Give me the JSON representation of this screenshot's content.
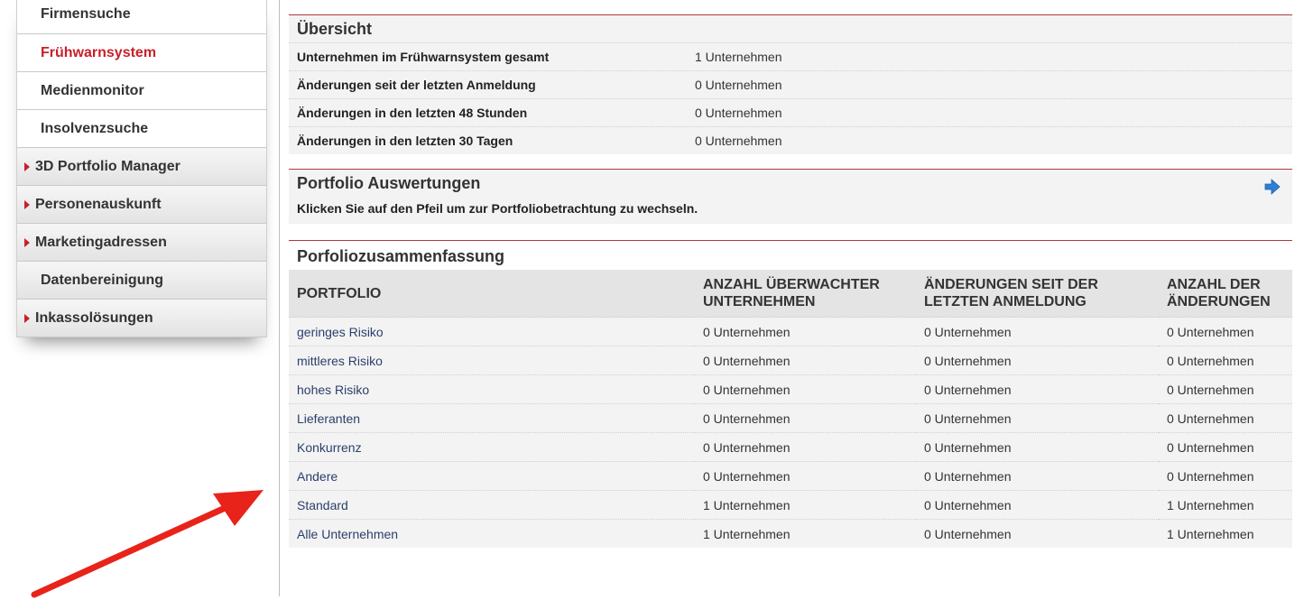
{
  "sidebar": {
    "items": [
      {
        "label": "Firmensuche",
        "type": "plain",
        "active": false
      },
      {
        "label": "Frühwarnsystem",
        "type": "plain",
        "active": true
      },
      {
        "label": "Medienmonitor",
        "type": "plain",
        "active": false
      },
      {
        "label": "Insolvenzsuche",
        "type": "plain",
        "active": false
      },
      {
        "label": "3D Portfolio Manager",
        "type": "group",
        "active": false
      },
      {
        "label": "Personenauskunft",
        "type": "group",
        "active": false
      },
      {
        "label": "Marketingadressen",
        "type": "group",
        "active": false
      },
      {
        "label": "Datenbereinigung",
        "type": "group-plain",
        "active": false
      },
      {
        "label": "Inkassolösungen",
        "type": "group",
        "active": false
      }
    ]
  },
  "overview": {
    "title": "Übersicht",
    "rows": [
      {
        "label": "Unternehmen im Frühwarnsystem gesamt",
        "value": "1 Unternehmen"
      },
      {
        "label": "Änderungen seit der letzten Anmeldung",
        "value": "0 Unternehmen"
      },
      {
        "label": "Änderungen in den letzten 48 Stunden",
        "value": "0 Unternehmen"
      },
      {
        "label": "Änderungen in den letzten 30 Tagen",
        "value": "0 Unternehmen"
      }
    ]
  },
  "portfolio_eval": {
    "title": "Portfolio Auswertungen",
    "description": "Klicken Sie auf den Pfeil um zur Portfoliobetrachtung zu wechseln.",
    "arrow_icon": "arrow-right-icon"
  },
  "summary": {
    "title": "Porfoliozusammenfassung",
    "headers": {
      "portfolio": "PORTFOLIO",
      "monitored": "ANZAHL ÜBERWACHTER UNTERNEHMEN",
      "changes_since": "ÄNDERUNGEN SEIT DER LETZTEN ANMELDUNG",
      "changes_count": "ANZAHL DER ÄNDERUNGEN"
    },
    "rows": [
      {
        "portfolio": "geringes Risiko",
        "monitored": "0 Unternehmen",
        "changes_since": "0 Unternehmen",
        "changes_count": "0 Unternehmen"
      },
      {
        "portfolio": "mittleres Risiko",
        "monitored": "0 Unternehmen",
        "changes_since": "0 Unternehmen",
        "changes_count": "0 Unternehmen"
      },
      {
        "portfolio": "hohes Risiko",
        "monitored": "0 Unternehmen",
        "changes_since": "0 Unternehmen",
        "changes_count": "0 Unternehmen"
      },
      {
        "portfolio": "Lieferanten",
        "monitored": "0 Unternehmen",
        "changes_since": "0 Unternehmen",
        "changes_count": "0 Unternehmen"
      },
      {
        "portfolio": "Konkurrenz",
        "monitored": "0 Unternehmen",
        "changes_since": "0 Unternehmen",
        "changes_count": "0 Unternehmen"
      },
      {
        "portfolio": "Andere",
        "monitored": "0 Unternehmen",
        "changes_since": "0 Unternehmen",
        "changes_count": "0 Unternehmen"
      },
      {
        "portfolio": "Standard",
        "monitored": "1 Unternehmen",
        "changes_since": "0 Unternehmen",
        "changes_count": "1 Unternehmen"
      },
      {
        "portfolio": "Alle Unternehmen",
        "monitored": "1 Unternehmen",
        "changes_since": "0 Unternehmen",
        "changes_count": "1 Unternehmen"
      }
    ]
  },
  "colors": {
    "accent_red": "#c8202a",
    "section_rule": "#b03a3a",
    "link_blue": "#2b3f6b",
    "arrow_blue": "#2e7fd6",
    "annotation_red": "#e8231a"
  }
}
